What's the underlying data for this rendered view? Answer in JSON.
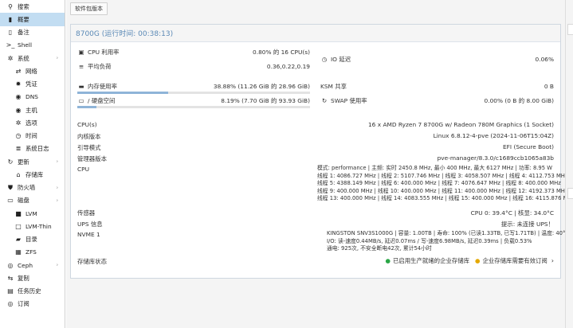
{
  "sidebar": {
    "items": [
      {
        "label": "搜索",
        "icon": "search-icon",
        "glyph": "⚲",
        "sub": false,
        "active": false
      },
      {
        "label": "概要",
        "icon": "book-icon",
        "glyph": "▮",
        "sub": false,
        "active": true
      },
      {
        "label": "备注",
        "icon": "note-icon",
        "glyph": "▯",
        "sub": false,
        "active": false
      },
      {
        "label": "Shell",
        "icon": "terminal-icon",
        "glyph": ">_",
        "sub": false,
        "active": false
      },
      {
        "label": "系统",
        "icon": "gears-icon",
        "glyph": "✲",
        "sub": false,
        "active": false,
        "chev": true
      },
      {
        "label": "网络",
        "icon": "exchange-icon",
        "glyph": "⇄",
        "sub": true,
        "active": false
      },
      {
        "label": "凭证",
        "icon": "certificate-icon",
        "glyph": "✹",
        "sub": true,
        "active": false
      },
      {
        "label": "DNS",
        "icon": "globe-icon",
        "glyph": "◉",
        "sub": true,
        "active": false
      },
      {
        "label": "主机",
        "icon": "globe-icon",
        "glyph": "◉",
        "sub": true,
        "active": false
      },
      {
        "label": "选项",
        "icon": "gear-icon",
        "glyph": "✲",
        "sub": true,
        "active": false
      },
      {
        "label": "时间",
        "icon": "clock-icon",
        "glyph": "◷",
        "sub": true,
        "active": false
      },
      {
        "label": "系统日志",
        "icon": "list-icon",
        "glyph": "≣",
        "sub": true,
        "active": false
      },
      {
        "label": "更新",
        "icon": "refresh-icon",
        "glyph": "↻",
        "sub": false,
        "active": false,
        "chev": true
      },
      {
        "label": "存储库",
        "icon": "repository-icon",
        "glyph": "⌂",
        "sub": true,
        "active": false
      },
      {
        "label": "防火墙",
        "icon": "shield-icon",
        "glyph": "⛊",
        "sub": false,
        "active": false,
        "chev": true
      },
      {
        "label": "磁盘",
        "icon": "hdd-icon",
        "glyph": "▭",
        "sub": false,
        "active": false,
        "chev": true
      },
      {
        "label": "LVM",
        "icon": "square-icon",
        "glyph": "■",
        "sub": true,
        "active": false
      },
      {
        "label": "LVM-Thin",
        "icon": "square-outline-icon",
        "glyph": "□",
        "sub": true,
        "active": false
      },
      {
        "label": "目录",
        "icon": "folder-icon",
        "glyph": "▰",
        "sub": true,
        "active": false
      },
      {
        "label": "ZFS",
        "icon": "grid-icon",
        "glyph": "▦",
        "sub": true,
        "active": false
      },
      {
        "label": "Ceph",
        "icon": "ceph-icon",
        "glyph": "◎",
        "sub": false,
        "active": false,
        "chev": true
      },
      {
        "label": "复制",
        "icon": "retweet-icon",
        "glyph": "⇆",
        "sub": false,
        "active": false
      },
      {
        "label": "任务历史",
        "icon": "list-alt-icon",
        "glyph": "▤",
        "sub": false,
        "active": false
      },
      {
        "label": "订阅",
        "icon": "support-icon",
        "glyph": "◎",
        "sub": false,
        "active": false
      }
    ]
  },
  "toolbar": {
    "package_versions_label": "软件包版本"
  },
  "panel": {
    "title": "8700G (运行时间: 00:38:13)"
  },
  "metrics": {
    "cpu_label": "CPU 利用率",
    "cpu_value": "0.80% 的 16 CPU(s)",
    "io_label": "IO 延迟",
    "io_value": "0.06%",
    "load_label": "平均负荷",
    "load_value": "0.36,0.22,0.19",
    "mem_label": "内存使用率",
    "mem_value": "38.88% (11.26 GiB 的 28.96 GiB)",
    "mem_fraction": 0.3888,
    "ksm_label": "KSM 共享",
    "ksm_value": "0 B",
    "disk_label": "/ 硬盘空间",
    "disk_value": "8.19% (7.70 GiB 的 93.93 GiB)",
    "disk_fraction": 0.0819,
    "swap_label": "SWAP 使用率",
    "swap_value": "0.00% (0 B 的 8.00 GiB)"
  },
  "info": {
    "cpus_label": "CPU(s)",
    "cpus_value": "16 x AMD Ryzen 7 8700G w/ Radeon 780M Graphics (1 Socket)",
    "kernel_label": "内核版本",
    "kernel_value": "Linux 6.8.12-4-pve (2024-11-06T15:04Z)",
    "boot_label": "引导模式",
    "boot_value": "EFI (Secure Boot)",
    "mgr_label": "管理器版本",
    "mgr_value": "pve-manager/8.3.0/c1689ccb1065a83b",
    "cpu_label": "CPU",
    "cpu_lines": [
      "模式: performance | 主频: 实时 2450.8 MHz, 最小 400 MHz, 最大 6127 MHz | 功率: 8.95 W",
      "线程 1: 4086.727 MHz | 线程 2: 5107.746 MHz | 线程 3: 4058.507 MHz | 线程 4: 4112.753 MHz",
      "线程 5: 4388.149 MHz | 线程 6: 400.000 MHz | 线程 7: 4076.647 MHz | 线程 8: 400.000 MHz",
      "线程 9: 400.000 MHz | 线程 10: 400.000 MHz | 线程 11: 400.000 MHz | 线程 12: 4192.373 MHz",
      "线程 13: 400.000 MHz | 线程 14: 4083.555 MHz | 线程 15: 400.000 MHz | 线程 16: 4115.876 MHz"
    ],
    "sensor_label": "传感器",
    "sensor_value": "CPU 0: 39.4°C | 核显: 34.0°C",
    "ups_label": "UPS 信息",
    "ups_value": "提示: 未连接 UPS！",
    "nvme_label": "NVME 1",
    "nvme_lines": [
      "KINGSTON SNV3S1000G | 容量: 1.00TB | 寿命: 100% (已读1.33TB, 已写1.71TB) | 温度: 40°C",
      "I/O: 读-速度0.44MB/s, 延迟0.07ms / 写-速度6.98MB/s, 延迟0.39ms | 负载0.53%",
      "通电: 925次, 不安全断电42次, 累计54小时"
    ],
    "repo_label": "存储库状态",
    "repo_ok": "已启用生产就绪的企业存储库",
    "repo_warn": "企业存储库需要有效订阅"
  }
}
